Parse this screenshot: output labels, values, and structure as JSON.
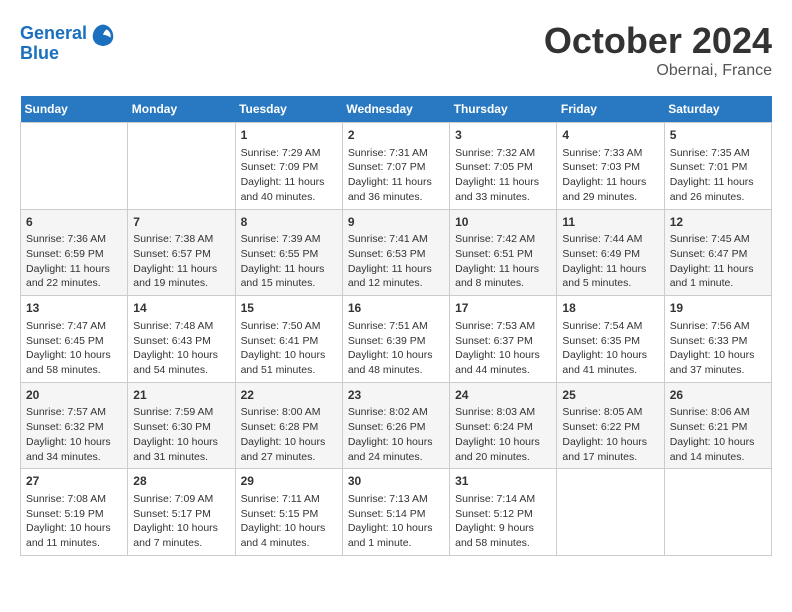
{
  "header": {
    "logo_line1": "General",
    "logo_line2": "Blue",
    "month": "October 2024",
    "location": "Obernai, France"
  },
  "weekdays": [
    "Sunday",
    "Monday",
    "Tuesday",
    "Wednesday",
    "Thursday",
    "Friday",
    "Saturday"
  ],
  "weeks": [
    [
      {
        "day": "",
        "sunrise": "",
        "sunset": "",
        "daylight": ""
      },
      {
        "day": "",
        "sunrise": "",
        "sunset": "",
        "daylight": ""
      },
      {
        "day": "1",
        "sunrise": "Sunrise: 7:29 AM",
        "sunset": "Sunset: 7:09 PM",
        "daylight": "Daylight: 11 hours and 40 minutes."
      },
      {
        "day": "2",
        "sunrise": "Sunrise: 7:31 AM",
        "sunset": "Sunset: 7:07 PM",
        "daylight": "Daylight: 11 hours and 36 minutes."
      },
      {
        "day": "3",
        "sunrise": "Sunrise: 7:32 AM",
        "sunset": "Sunset: 7:05 PM",
        "daylight": "Daylight: 11 hours and 33 minutes."
      },
      {
        "day": "4",
        "sunrise": "Sunrise: 7:33 AM",
        "sunset": "Sunset: 7:03 PM",
        "daylight": "Daylight: 11 hours and 29 minutes."
      },
      {
        "day": "5",
        "sunrise": "Sunrise: 7:35 AM",
        "sunset": "Sunset: 7:01 PM",
        "daylight": "Daylight: 11 hours and 26 minutes."
      }
    ],
    [
      {
        "day": "6",
        "sunrise": "Sunrise: 7:36 AM",
        "sunset": "Sunset: 6:59 PM",
        "daylight": "Daylight: 11 hours and 22 minutes."
      },
      {
        "day": "7",
        "sunrise": "Sunrise: 7:38 AM",
        "sunset": "Sunset: 6:57 PM",
        "daylight": "Daylight: 11 hours and 19 minutes."
      },
      {
        "day": "8",
        "sunrise": "Sunrise: 7:39 AM",
        "sunset": "Sunset: 6:55 PM",
        "daylight": "Daylight: 11 hours and 15 minutes."
      },
      {
        "day": "9",
        "sunrise": "Sunrise: 7:41 AM",
        "sunset": "Sunset: 6:53 PM",
        "daylight": "Daylight: 11 hours and 12 minutes."
      },
      {
        "day": "10",
        "sunrise": "Sunrise: 7:42 AM",
        "sunset": "Sunset: 6:51 PM",
        "daylight": "Daylight: 11 hours and 8 minutes."
      },
      {
        "day": "11",
        "sunrise": "Sunrise: 7:44 AM",
        "sunset": "Sunset: 6:49 PM",
        "daylight": "Daylight: 11 hours and 5 minutes."
      },
      {
        "day": "12",
        "sunrise": "Sunrise: 7:45 AM",
        "sunset": "Sunset: 6:47 PM",
        "daylight": "Daylight: 11 hours and 1 minute."
      }
    ],
    [
      {
        "day": "13",
        "sunrise": "Sunrise: 7:47 AM",
        "sunset": "Sunset: 6:45 PM",
        "daylight": "Daylight: 10 hours and 58 minutes."
      },
      {
        "day": "14",
        "sunrise": "Sunrise: 7:48 AM",
        "sunset": "Sunset: 6:43 PM",
        "daylight": "Daylight: 10 hours and 54 minutes."
      },
      {
        "day": "15",
        "sunrise": "Sunrise: 7:50 AM",
        "sunset": "Sunset: 6:41 PM",
        "daylight": "Daylight: 10 hours and 51 minutes."
      },
      {
        "day": "16",
        "sunrise": "Sunrise: 7:51 AM",
        "sunset": "Sunset: 6:39 PM",
        "daylight": "Daylight: 10 hours and 48 minutes."
      },
      {
        "day": "17",
        "sunrise": "Sunrise: 7:53 AM",
        "sunset": "Sunset: 6:37 PM",
        "daylight": "Daylight: 10 hours and 44 minutes."
      },
      {
        "day": "18",
        "sunrise": "Sunrise: 7:54 AM",
        "sunset": "Sunset: 6:35 PM",
        "daylight": "Daylight: 10 hours and 41 minutes."
      },
      {
        "day": "19",
        "sunrise": "Sunrise: 7:56 AM",
        "sunset": "Sunset: 6:33 PM",
        "daylight": "Daylight: 10 hours and 37 minutes."
      }
    ],
    [
      {
        "day": "20",
        "sunrise": "Sunrise: 7:57 AM",
        "sunset": "Sunset: 6:32 PM",
        "daylight": "Daylight: 10 hours and 34 minutes."
      },
      {
        "day": "21",
        "sunrise": "Sunrise: 7:59 AM",
        "sunset": "Sunset: 6:30 PM",
        "daylight": "Daylight: 10 hours and 31 minutes."
      },
      {
        "day": "22",
        "sunrise": "Sunrise: 8:00 AM",
        "sunset": "Sunset: 6:28 PM",
        "daylight": "Daylight: 10 hours and 27 minutes."
      },
      {
        "day": "23",
        "sunrise": "Sunrise: 8:02 AM",
        "sunset": "Sunset: 6:26 PM",
        "daylight": "Daylight: 10 hours and 24 minutes."
      },
      {
        "day": "24",
        "sunrise": "Sunrise: 8:03 AM",
        "sunset": "Sunset: 6:24 PM",
        "daylight": "Daylight: 10 hours and 20 minutes."
      },
      {
        "day": "25",
        "sunrise": "Sunrise: 8:05 AM",
        "sunset": "Sunset: 6:22 PM",
        "daylight": "Daylight: 10 hours and 17 minutes."
      },
      {
        "day": "26",
        "sunrise": "Sunrise: 8:06 AM",
        "sunset": "Sunset: 6:21 PM",
        "daylight": "Daylight: 10 hours and 14 minutes."
      }
    ],
    [
      {
        "day": "27",
        "sunrise": "Sunrise: 7:08 AM",
        "sunset": "Sunset: 5:19 PM",
        "daylight": "Daylight: 10 hours and 11 minutes."
      },
      {
        "day": "28",
        "sunrise": "Sunrise: 7:09 AM",
        "sunset": "Sunset: 5:17 PM",
        "daylight": "Daylight: 10 hours and 7 minutes."
      },
      {
        "day": "29",
        "sunrise": "Sunrise: 7:11 AM",
        "sunset": "Sunset: 5:15 PM",
        "daylight": "Daylight: 10 hours and 4 minutes."
      },
      {
        "day": "30",
        "sunrise": "Sunrise: 7:13 AM",
        "sunset": "Sunset: 5:14 PM",
        "daylight": "Daylight: 10 hours and 1 minute."
      },
      {
        "day": "31",
        "sunrise": "Sunrise: 7:14 AM",
        "sunset": "Sunset: 5:12 PM",
        "daylight": "Daylight: 9 hours and 58 minutes."
      },
      {
        "day": "",
        "sunrise": "",
        "sunset": "",
        "daylight": ""
      },
      {
        "day": "",
        "sunrise": "",
        "sunset": "",
        "daylight": ""
      }
    ]
  ]
}
